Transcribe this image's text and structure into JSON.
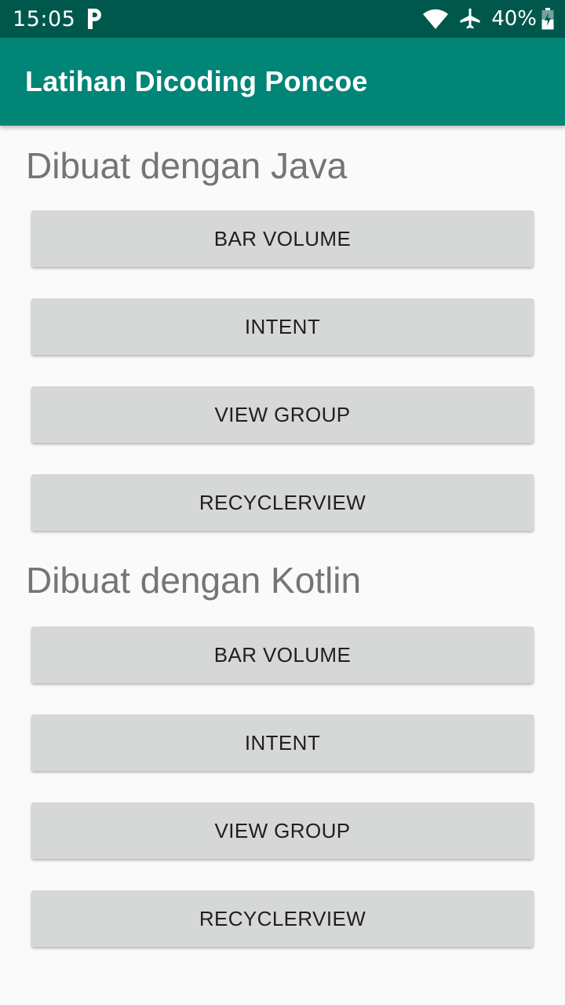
{
  "status_bar": {
    "time": "15:05",
    "battery_percent": "40%",
    "icons": [
      "parking-notification-icon",
      "wifi-icon",
      "airplane-mode-icon",
      "battery-charging-icon"
    ]
  },
  "app_bar": {
    "title": "Latihan Dicoding Poncoe"
  },
  "colors": {
    "status_bar": "#00574b",
    "app_bar": "#008577",
    "button": "#d6d7d7",
    "heading": "#757575"
  },
  "java_section": {
    "heading": "Dibuat dengan Java",
    "buttons": [
      "BAR VOLUME",
      "INTENT",
      "VIEW GROUP",
      "RECYCLERVIEW"
    ]
  },
  "kotlin_section": {
    "heading": "Dibuat dengan Kotlin",
    "buttons": [
      "BAR VOLUME",
      "INTENT",
      "VIEW GROUP",
      "RECYCLERVIEW"
    ]
  }
}
